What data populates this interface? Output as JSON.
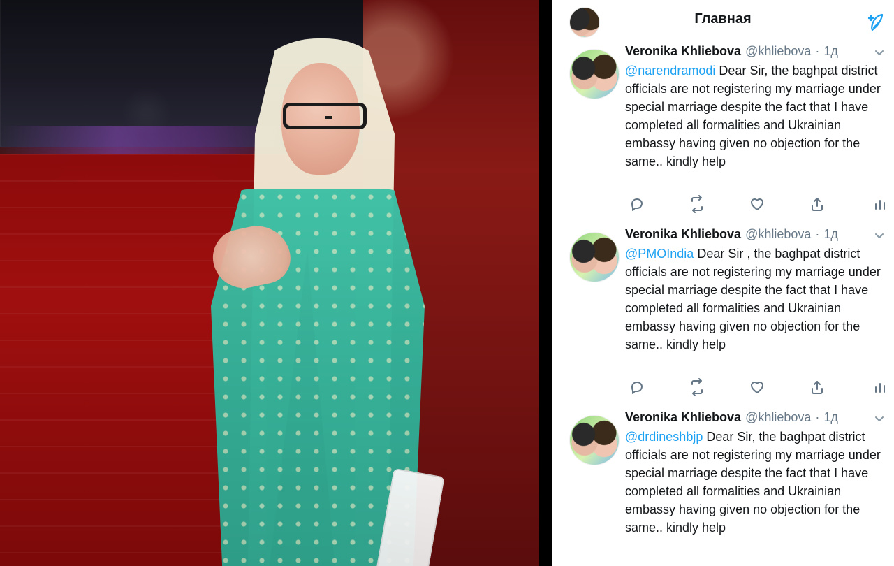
{
  "header": {
    "title": "Главная",
    "compose_icon": "compose-feather-icon",
    "avatar_icon": "avatar"
  },
  "tweets": [
    {
      "author_name": "Veronika Khliebova",
      "author_handle": "@khliebova",
      "separator": "·",
      "time": "1д",
      "mention": "@narendramodi",
      "text_after_mention": " Dear Sir, the baghpat district officials are not registering my marriage under special marriage despite the fact that I have completed all formalities and Ukrainian embassy having given no objection for the same.. kindly help"
    },
    {
      "author_name": "Veronika Khliebova",
      "author_handle": "@khliebova",
      "separator": "·",
      "time": "1д",
      "mention": "@PMOIndia",
      "text_after_mention": " Dear Sir , the baghpat district officials are not registering my marriage under special marriage despite the fact that I have completed all formalities and Ukrainian embassy having given no objection for the same.. kindly help"
    },
    {
      "author_name": "Veronika Khliebova",
      "author_handle": "@khliebova",
      "separator": "·",
      "time": "1д",
      "mention": "@drdineshbjp",
      "text_after_mention": " Dear Sir, the baghpat district officials are not registering my marriage under special marriage despite the fact that I have completed all formalities and Ukrainian embassy having given no objection for the same.. kindly help"
    }
  ],
  "colors": {
    "accent": "#1da1f2",
    "text": "#14171a",
    "muted": "#657786",
    "divider": "#e6ecf0"
  }
}
